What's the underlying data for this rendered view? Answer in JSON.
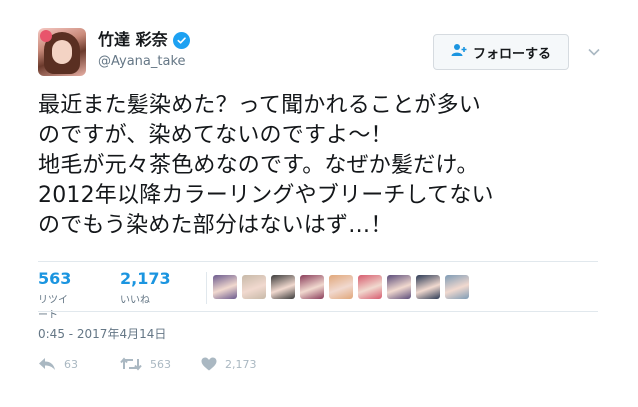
{
  "user": {
    "display_name": "竹達 彩奈",
    "handle": "@Ayana_take",
    "avatar_icon": "profile-avatar"
  },
  "follow_button": {
    "label": "フォローする",
    "icon": "add-user-icon"
  },
  "tweet": {
    "lines": [
      "最近また髪染めた？って聞かれることが多い",
      "のですが、染めてないのですよ〜！",
      "地毛が元々茶色めなのです。なぜか髪だけ。",
      "2012年以降カラーリングやブリーチしてない",
      "のでもう染めた部分はないはず…！"
    ]
  },
  "stats": {
    "retweets": {
      "count": "563",
      "label": "リツイート"
    },
    "likes": {
      "count": "2,173",
      "label": "いいね"
    }
  },
  "likers": [
    {
      "name": "liker-1",
      "color": "#6b5a8e"
    },
    {
      "name": "liker-2",
      "color": "#c7b9a8"
    },
    {
      "name": "liker-3",
      "color": "#3b3b3b"
    },
    {
      "name": "liker-4",
      "color": "#8a3d5a"
    },
    {
      "name": "liker-5",
      "color": "#e0a77a"
    },
    {
      "name": "liker-6",
      "color": "#d65b6e"
    },
    {
      "name": "liker-7",
      "color": "#5b4c7a"
    },
    {
      "name": "liker-8",
      "color": "#2b3a55"
    },
    {
      "name": "liker-9",
      "color": "#7d9bb5"
    }
  ],
  "timestamp": "0:45 - 2017年4月14日",
  "actions": {
    "reply": {
      "count": "63",
      "icon": "reply-icon"
    },
    "retweet": {
      "count": "563",
      "icon": "retweet-icon"
    },
    "like": {
      "count": "2,173",
      "icon": "heart-icon"
    }
  },
  "colors": {
    "accent": "#1b95e0",
    "verified": "#1da1f2",
    "muted": "#657786",
    "icon_gray": "#aab8c2"
  }
}
